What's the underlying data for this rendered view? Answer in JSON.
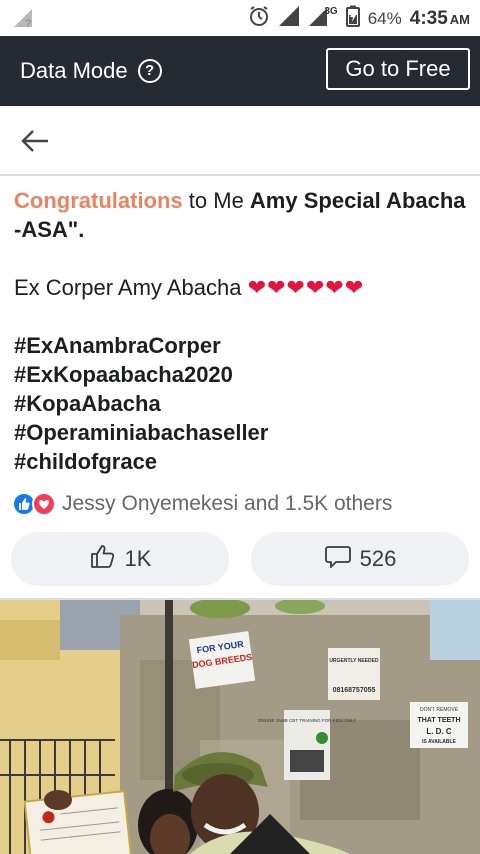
{
  "status_bar": {
    "network": "3G",
    "battery": "64%",
    "time": "4:35",
    "ampm": "AM"
  },
  "data_bar": {
    "label": "Data Mode",
    "go_free": "Go to Free"
  },
  "post": {
    "congrats_word": "Congratulations",
    "line1_rest": " to Me ",
    "name": "Amy Special Abacha -ASA\".",
    "line2": "Ex Corper Amy Abacha ",
    "hearts": "❤❤❤❤❤❤",
    "hashtags": [
      "#ExAnambraCorper",
      "#ExKopaabacha2020",
      "#KopaAbacha",
      "#Operaminiabachaseller",
      "#childofgrace"
    ]
  },
  "reactions": {
    "text": "Jessy Onyemekesi and 1.5K others"
  },
  "actions": {
    "like_count": "1K",
    "comment_count": "526"
  },
  "photo_signs": {
    "sign1_line1": "FOR YOUR",
    "sign1_line2": "DOG BREEDS",
    "sign2": "URGENTLY NEEDED",
    "sign2_phone": "08168757055",
    "sign3_line1": "DON'T REMOVE",
    "sign3_line2": "THAT TEETH",
    "sign3_line3": "L. D. C",
    "sign3_line4": "IS AVAILABLE",
    "sign4": "ONLINE JAMB CBT TRAINING FOR KIDS ONLY"
  }
}
